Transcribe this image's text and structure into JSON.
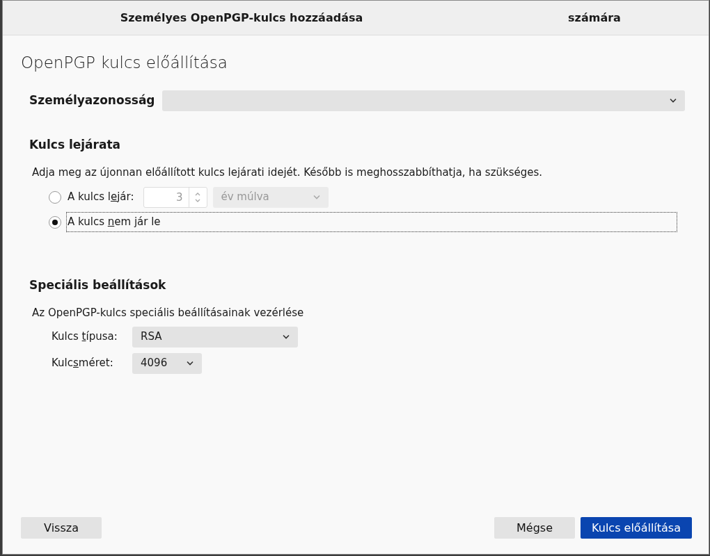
{
  "window": {
    "title_parts": [
      "Személyes OpenPGP-kulcs hozzáadása",
      "számára"
    ]
  },
  "heading": "OpenPGP kulcs előállítása",
  "identity": {
    "label": "Személyazonosság"
  },
  "expiry": {
    "title": "Kulcs lejárata",
    "description": "Adja meg az újonnan előállított kulcs lejárati idejét. Később is meghosszabbíthatja, ha szükséges.",
    "options": [
      {
        "kind": "duration",
        "label": [
          "A kulcs l",
          "e",
          "jár:"
        ],
        "selected": false,
        "focused": false,
        "amount": "3",
        "unit": "év múlva"
      },
      {
        "kind": "plain",
        "label": [
          "A kulcs ",
          "n",
          "em jár le"
        ],
        "selected": true,
        "focused": true
      }
    ]
  },
  "advanced": {
    "title": "Speciális beállítások",
    "description": "Az OpenPGP-kulcs speciális beállításainak vezérlése",
    "fields": [
      {
        "label": [
          "Kulcs ",
          "t",
          "ípusa:"
        ],
        "value": "RSA"
      },
      {
        "label": [
          "Kulc",
          "s",
          "méret:"
        ],
        "value": "4096"
      }
    ]
  },
  "buttons": [
    {
      "label": "Vissza",
      "kind": "secondary"
    },
    {
      "label": "Mégse",
      "kind": "secondary"
    },
    {
      "label": "Kulcs előállítása",
      "kind": "primary"
    }
  ]
}
